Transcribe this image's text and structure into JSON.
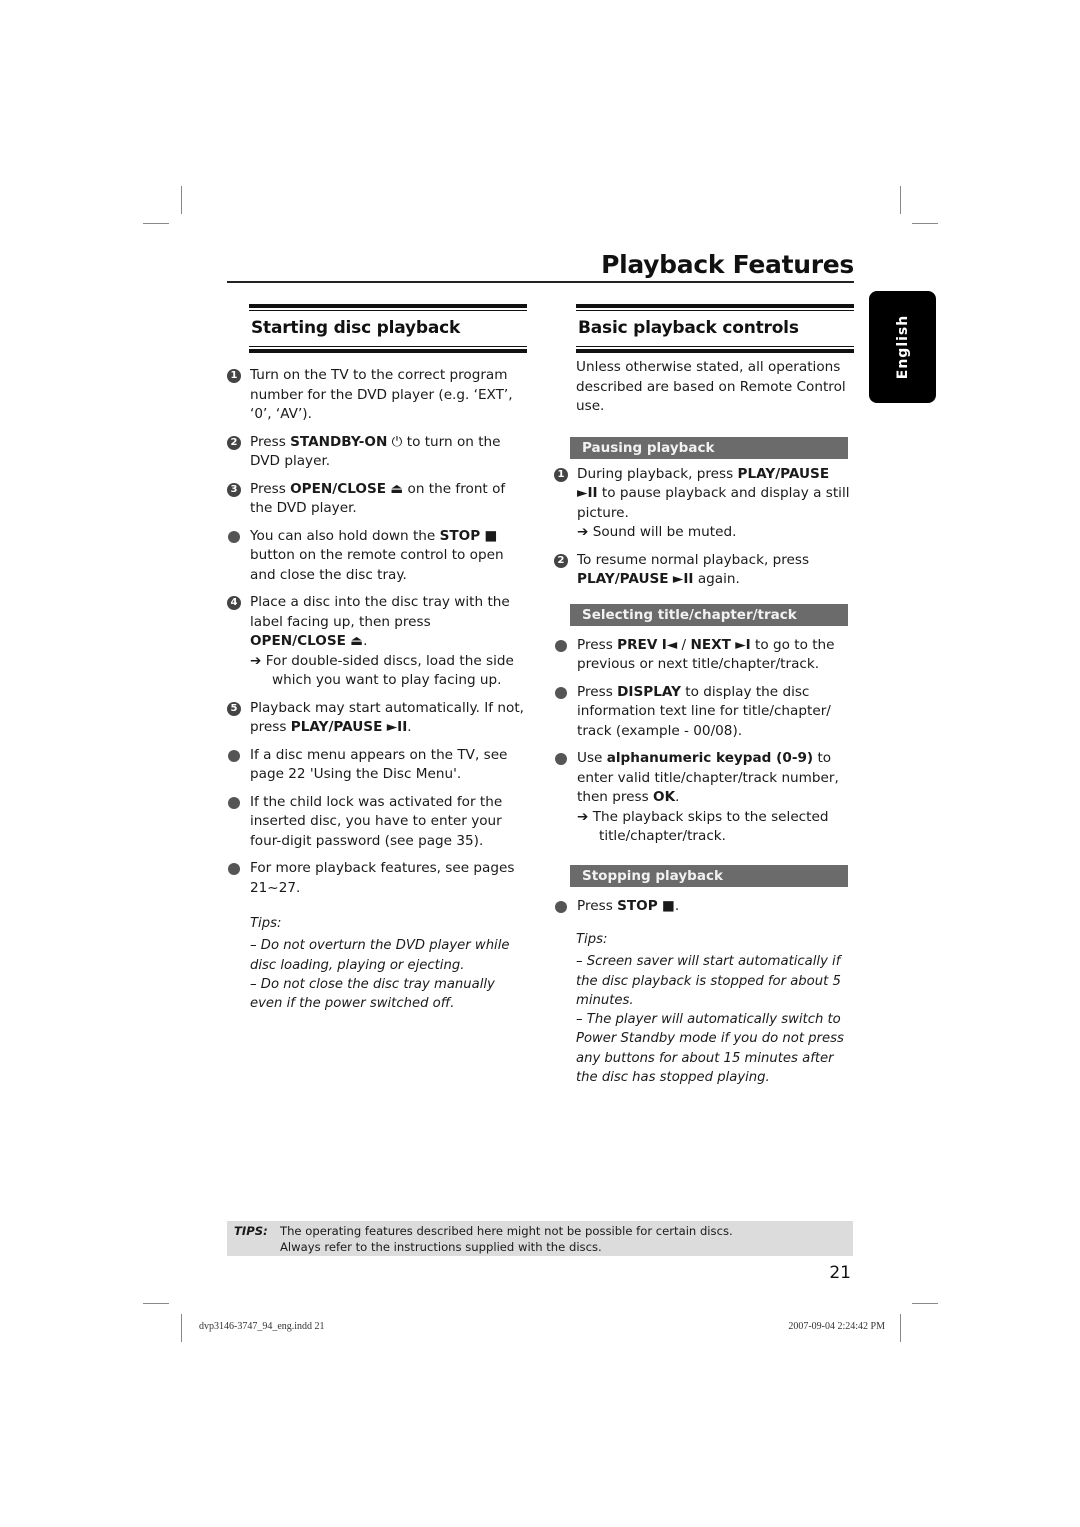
{
  "header": {
    "title": "Playback Features"
  },
  "language_tab": {
    "label": "English"
  },
  "left": {
    "section_title": "Starting disc playback",
    "items": [
      {
        "marker": "1",
        "kind": "number",
        "segments": [
          "Turn on the TV to the correct program number for the DVD player (e.g. ‘EXT’, ‘0’, ‘AV’)."
        ]
      },
      {
        "marker": "2",
        "kind": "number",
        "pre": "Press ",
        "bold": "STANDBY-ON",
        "icon": "⏻",
        "post": " to turn on the DVD player."
      },
      {
        "marker": "3",
        "kind": "number",
        "pre": "Press ",
        "bold": "OPEN/CLOSE",
        "icon": "⏏",
        "post": " on the front of the DVD player."
      },
      {
        "marker": "",
        "kind": "bullet",
        "pre": "You can also hold down the ",
        "bold": "STOP",
        "icon": "■",
        "post": " button on the remote control to open and close the disc tray."
      },
      {
        "marker": "4",
        "kind": "number",
        "pre": "Place a disc into the disc tray with the label facing up, then press ",
        "bold": "OPEN/CLOSE",
        "icon": "⏏",
        "post": ".",
        "note": "For double-sided discs, load the side which you want to play facing up."
      },
      {
        "marker": "5",
        "kind": "number",
        "pre": "Playback may start automatically. If not, press ",
        "bold": "PLAY/PAUSE",
        "icon": "►II",
        "post": "."
      },
      {
        "marker": "",
        "kind": "bullet",
        "pre": "If a disc menu appears on the TV, see page 22 'Using the Disc Menu'."
      },
      {
        "marker": "",
        "kind": "bullet",
        "pre": "If the child lock was activated for the inserted disc, you have to enter your four-digit password (see page 35)."
      },
      {
        "marker": "",
        "kind": "bullet",
        "pre": "For more playback features, see pages 21~27."
      }
    ],
    "tips_label": "Tips:",
    "tips": [
      "– Do not overturn the DVD player while disc loading, playing or ejecting.",
      "– Do not close the disc tray manually even if the power switched off."
    ]
  },
  "right": {
    "section_title": "Basic playback controls",
    "intro": "Unless otherwise stated, all operations described are based on Remote Control use.",
    "pausing": {
      "heading": "Pausing playback",
      "item1_pre": "During playback, press ",
      "item1_bold": "PLAY/PAUSE",
      "item1_icon": "►II",
      "item1_post": " to pause playback and display a still picture.",
      "item1_note": "Sound will be muted.",
      "item2_pre": "To resume normal playback, press ",
      "item2_bold": "PLAY/PAUSE",
      "item2_icon": "►II",
      "item2_post": " again."
    },
    "selecting": {
      "heading": "Selecting title/chapter/track",
      "item1_pre": "Press ",
      "item1_bold1": "PREV",
      "item1_icon1": "I◄",
      "item1_sep": " / ",
      "item1_bold2": "NEXT",
      "item1_icon2": "►I",
      "item1_post": " to go to the previous or next title/chapter/track.",
      "item2_pre": "Press ",
      "item2_bold": "DISPLAY",
      "item2_post": " to display the disc information text line for title/chapter/ track (example - 00/08).",
      "item3_pre": "Use ",
      "item3_bold": "alphanumeric keypad (0-9)",
      "item3_mid": " to enter valid title/chapter/track number, then press ",
      "item3_bold2": "OK",
      "item3_post": ".",
      "item3_note": "The playback skips to the selected title/chapter/track."
    },
    "stopping": {
      "heading": "Stopping playback",
      "item1_pre": "Press ",
      "item1_bold": "STOP",
      "item1_icon": "■",
      "item1_post": "."
    },
    "tips_label": "Tips:",
    "tips": [
      "– Screen saver will start automatically if the disc playback is stopped for about 5 minutes.",
      "– The player will automatically switch to Power Standby mode if you do not press any buttons for about 15 minutes after the disc has stopped playing."
    ]
  },
  "footer_tips": {
    "label": "TIPS:",
    "line1": "The operating features described here might not be possible for certain discs.",
    "line2": "Always refer to the instructions supplied with the discs."
  },
  "page_number": "21",
  "slug": {
    "file": "dvp3146-3747_94_eng.indd   21",
    "timestamp": "2007-09-04   2:24:42 PM"
  }
}
